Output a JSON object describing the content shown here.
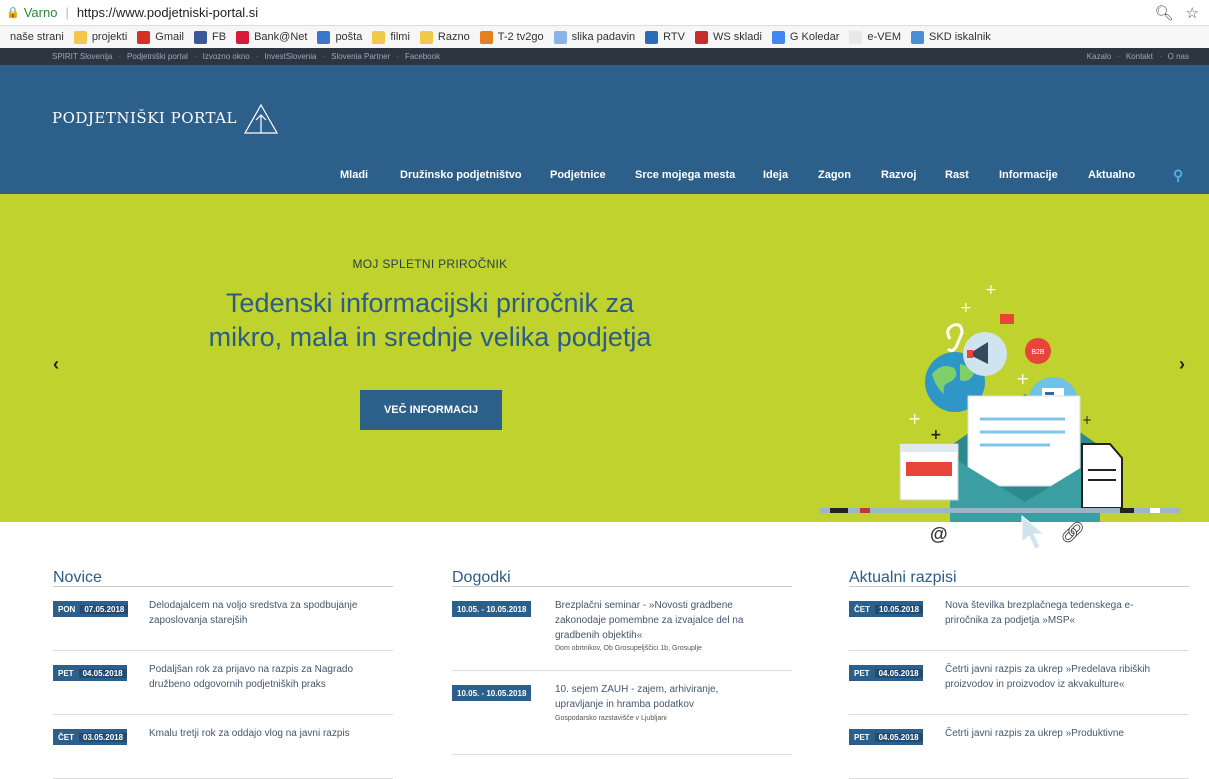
{
  "browser": {
    "secure_label": "Varno",
    "url": "https://www.podjetniski-portal.si"
  },
  "bookmarks": [
    {
      "label": "naše strani",
      "color": ""
    },
    {
      "label": "projekti",
      "color": "#f1c84b"
    },
    {
      "label": "Gmail",
      "color": "#d93025"
    },
    {
      "label": "FB",
      "color": "#3b5998"
    },
    {
      "label": "Bank@Net",
      "color": "#d71a3a"
    },
    {
      "label": "pošta",
      "color": "#3a76c9"
    },
    {
      "label": "filmi",
      "color": "#f1c84b"
    },
    {
      "label": "Razno",
      "color": "#f1c84b"
    },
    {
      "label": "T-2 tv2go",
      "color": "#e67e22"
    },
    {
      "label": "slika padavin",
      "color": "#8ab4e8"
    },
    {
      "label": "RTV",
      "color": "#2a6db5"
    },
    {
      "label": "WS skladi",
      "color": "#c72c2c"
    },
    {
      "label": "G Koledar",
      "color": "#4285f4"
    },
    {
      "label": "e-VEM",
      "color": "#e8e8e8"
    },
    {
      "label": "SKD iskalnik",
      "color": "#4a8fd6"
    }
  ],
  "top_strip": {
    "left": [
      "SPIRIT Slovenija",
      "Podjetniški portal",
      "Izvozno okno",
      "InvestSlovenia",
      "Slovenia Partner",
      "Facebook"
    ],
    "right": [
      "Kazalo",
      "Kontakt",
      "O nas"
    ]
  },
  "header": {
    "logo": "PODJETNIŠKI PORTAL",
    "nav": [
      "Mladi",
      "Družinsko podjetništvo",
      "Podjetnice",
      "Srce mojega mesta",
      "Ideja",
      "Zagon",
      "Razvoj",
      "Rast",
      "Informacije",
      "Aktualno"
    ]
  },
  "hero": {
    "kicker": "MOJ SPLETNI PRIROČNIK",
    "headline_1": "Tedenski informacijski priročnik za",
    "headline_2": "mikro, mala in srednje velika podjetja",
    "cta": "VEČ INFORMACIJ",
    "badge_b2b": "B2B",
    "prev": "‹",
    "next": "›"
  },
  "novice": {
    "title": "Novice",
    "items": [
      {
        "day": "PON",
        "date": "07.05.2018",
        "text_1": "Delodajalcem na voljo sredstva za spodbujanje",
        "text_2": "zaposlovanja starejših"
      },
      {
        "day": "PET",
        "date": "04.05.2018",
        "text_1": "Podaljšan rok za prijavo na razpis za Nagrado",
        "text_2": "družbeno odgovornih podjetniških praks"
      },
      {
        "day": "ČET",
        "date": "03.05.2018",
        "text_1": "Kmalu tretji rok za oddajo vlog na javni razpis",
        "text_2": ""
      }
    ]
  },
  "dogodki": {
    "title": "Dogodki",
    "items": [
      {
        "date": "10.05. - 10.05.2018",
        "text_1": "Brezplačni seminar - »Novosti gradbene",
        "text_2": "zakonodaje pomembne za izvajalce del na",
        "text_3": "gradbenih objektih«",
        "sub": "Dom obrtnikov, Ob Grosupeljščici 1b, Grosuplje"
      },
      {
        "date": "10.05. - 10.05.2018",
        "text_1": "10. sejem ZAUH - zajem, arhiviranje,",
        "text_2": "upravljanje in hramba podatkov",
        "text_3": "",
        "sub": "Gospodarsko razstavišče v Ljubljani"
      }
    ]
  },
  "razpisi": {
    "title": "Aktualni razpisi",
    "items": [
      {
        "day": "ČET",
        "date": "10.05.2018",
        "text_1": "Nova številka brezplačnega tedenskega e-",
        "text_2": "priročnika za podjetja »MSP«"
      },
      {
        "day": "PET",
        "date": "04.05.2018",
        "text_1": "Četrti javni razpis za ukrep »Predelava ribiških",
        "text_2": "proizvodov in proizvodov iz akvakulture«"
      },
      {
        "day": "PET",
        "date": "04.05.2018",
        "text_1": "Četrti javni razpis za ukrep »Produktivne",
        "text_2": ""
      }
    ]
  }
}
